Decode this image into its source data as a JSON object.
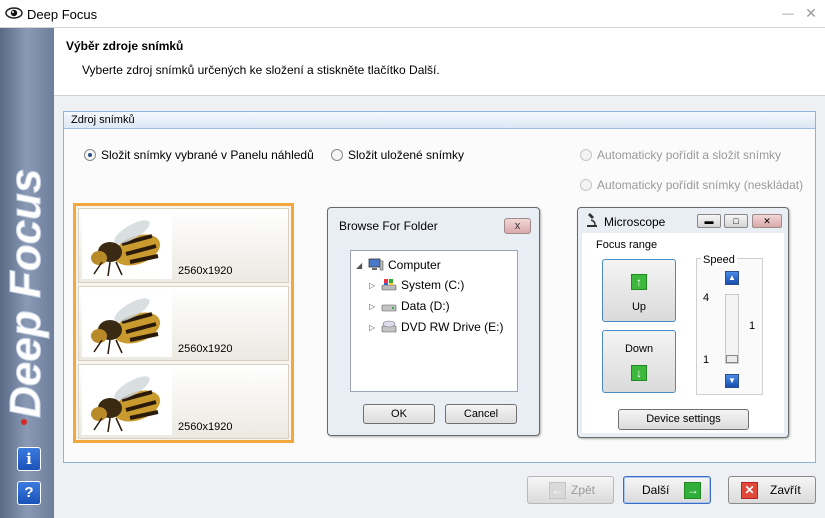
{
  "window": {
    "title": "Deep Focus"
  },
  "sidebar": {
    "logo_text": "Deep Focus",
    "info_label": "i",
    "help_label": "?"
  },
  "header": {
    "title": "Výběr zdroje snímků",
    "description": "Vyberte zdroj snímků určených ke složení a stiskněte tlačítko Další."
  },
  "source": {
    "group_title": "Zdroj snímků",
    "options": [
      {
        "label": "Složit snímky vybrané v Panelu náhledů",
        "selected": true,
        "enabled": true
      },
      {
        "label": "Složit uložené snímky",
        "selected": false,
        "enabled": true
      },
      {
        "label": "Automaticky pořídit a složit snímky",
        "selected": false,
        "enabled": false
      },
      {
        "label": "Automaticky pořídit snímky (neskládat)",
        "selected": false,
        "enabled": false
      }
    ],
    "thumbnails": [
      {
        "size": "2560x1920"
      },
      {
        "size": "2560x1920"
      },
      {
        "size": "2560x1920"
      }
    ]
  },
  "browse_dialog": {
    "title": "Browse For Folder",
    "close_label": "x",
    "tree": [
      {
        "label": "Computer",
        "icon": "computer-icon"
      },
      {
        "label": "System (C:)",
        "icon": "system-drive-icon"
      },
      {
        "label": "Data (D:)",
        "icon": "drive-icon"
      },
      {
        "label": "DVD RW Drive (E:)",
        "icon": "dvd-drive-icon"
      }
    ],
    "ok_label": "OK",
    "cancel_label": "Cancel"
  },
  "microscope": {
    "title": "Microscope",
    "focus_range_label": "Focus range",
    "up_label": "Up",
    "down_label": "Down",
    "speed_label": "Speed",
    "speed_max": "4",
    "speed_min": "1",
    "speed_value": "1",
    "device_settings_label": "Device settings"
  },
  "footer": {
    "back_label": "Zpět",
    "next_label": "Další",
    "close_label": "Zavřít"
  },
  "colors": {
    "thumb_border": "#f4a73c",
    "group_border": "#8fb2dc",
    "next_arrow": "#2fae3a",
    "close_x": "#e0483a"
  }
}
